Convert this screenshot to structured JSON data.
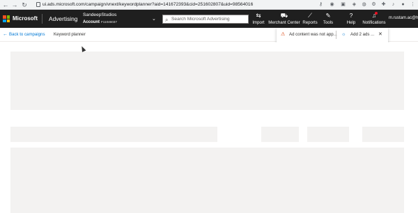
{
  "browser": {
    "url": "ui.ads.microsoft.com/campaign/vnext/keywordplanner?aid=141672393&cid=251602807&uid=98564016",
    "back_glyph": "←",
    "forward_glyph": "→",
    "reload_glyph": "↻"
  },
  "header": {
    "brand": "Microsoft",
    "product": "Advertising",
    "account_name": "SandeepStudios",
    "account_label": "Account",
    "account_id": "F11046037",
    "search_placeholder": "Search Microsoft Advertising",
    "buttons": [
      {
        "id": "import",
        "label": "Import",
        "icon": "import-icon",
        "glyph": "⇆"
      },
      {
        "id": "merchant-center",
        "label": "Merchant Center",
        "icon": "cart-icon",
        "glyph": "⛟"
      },
      {
        "id": "reports",
        "label": "Reports",
        "icon": "reports-icon",
        "glyph": "⟋"
      },
      {
        "id": "tools",
        "label": "Tools",
        "icon": "tools-icon",
        "glyph": "✎"
      },
      {
        "id": "help",
        "label": "Help",
        "icon": "help-icon",
        "glyph": "?"
      },
      {
        "id": "notifications",
        "label": "Notifications",
        "icon": "bell-icon",
        "glyph": "♫"
      }
    ],
    "user_email": "m.rustam.ac@hot"
  },
  "subheader": {
    "back_label": "Back to campaigns",
    "page_title": "Keyword planner"
  },
  "notifications": {
    "warning_text": "Ad content was not app...",
    "tip_text": "Add 2 ads ...",
    "close_glyph": "✕"
  },
  "colors": {
    "header_bg": "#1f1f1f",
    "link": "#0078d4",
    "placeholder": "#f3f2f1",
    "warning": "#d83b01",
    "ms_red": "#f25022",
    "ms_green": "#7fba00",
    "ms_blue": "#00a4ef",
    "ms_yellow": "#ffb900"
  }
}
